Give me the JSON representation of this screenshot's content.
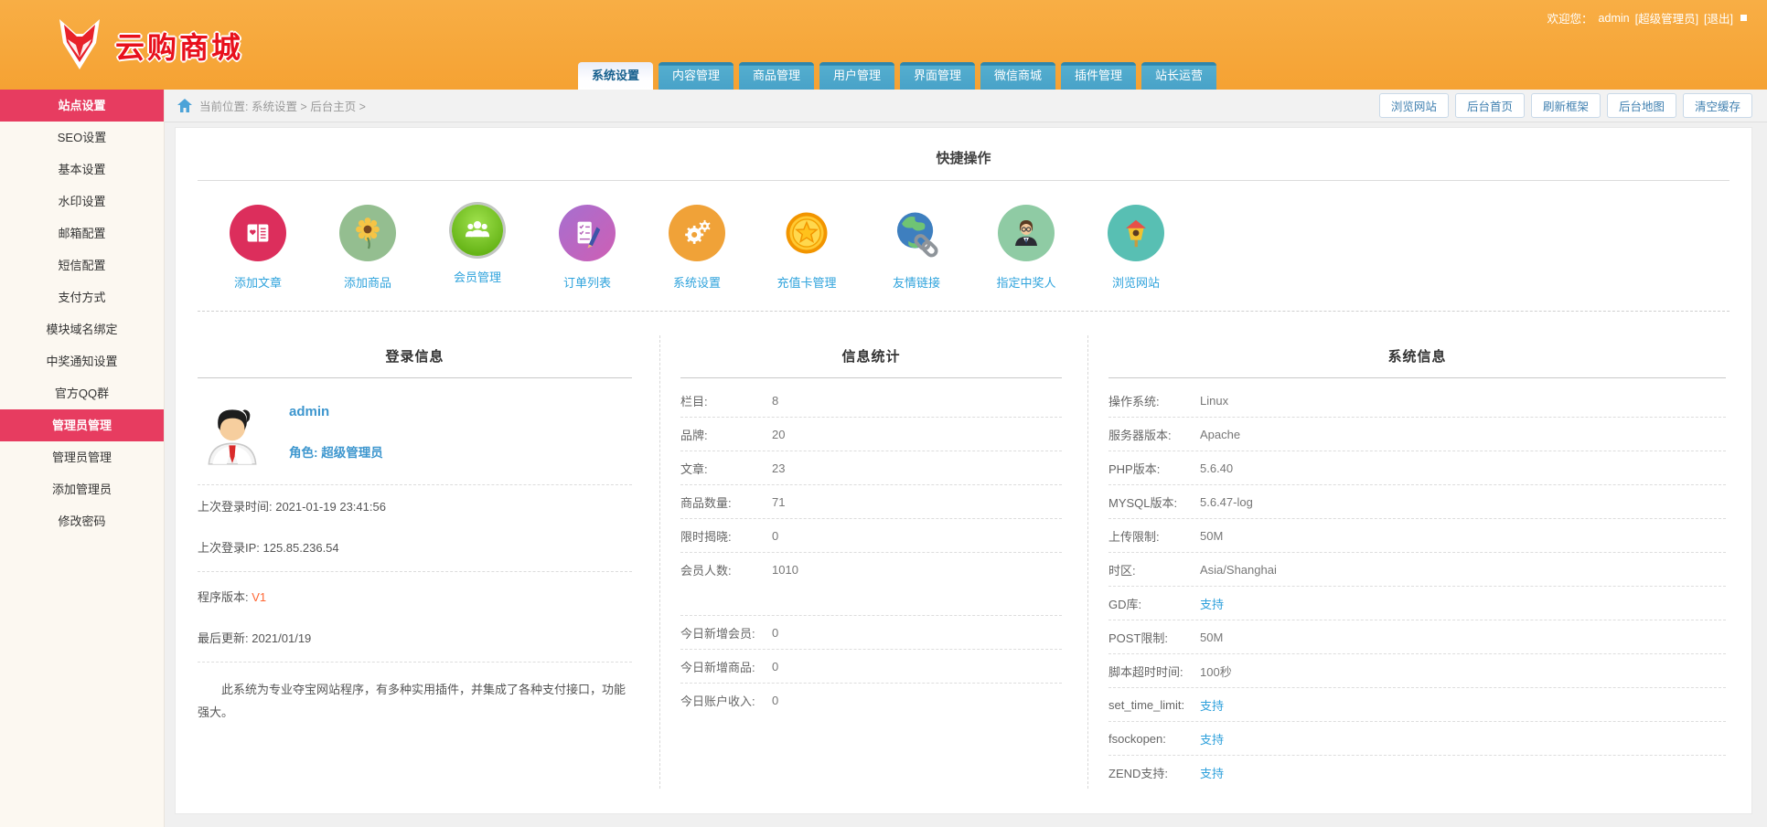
{
  "header": {
    "welcome_prefix": "欢迎您：",
    "username": "admin",
    "role_bracket": "[超级管理员]",
    "logout_label": "[退出]",
    "logo_text": "云购商城",
    "tabs": [
      {
        "label": "系统设置",
        "active": true
      },
      {
        "label": "内容管理",
        "active": false
      },
      {
        "label": "商品管理",
        "active": false
      },
      {
        "label": "用户管理",
        "active": false
      },
      {
        "label": "界面管理",
        "active": false
      },
      {
        "label": "微信商城",
        "active": false
      },
      {
        "label": "插件管理",
        "active": false
      },
      {
        "label": "站长运营",
        "active": false
      }
    ]
  },
  "breadcrumb": {
    "text": "当前位置: 系统设置 > 后台主页 >",
    "actions": [
      {
        "label": "浏览网站"
      },
      {
        "label": "后台首页"
      },
      {
        "label": "刷新框架"
      },
      {
        "label": "后台地图"
      },
      {
        "label": "清空缓存"
      }
    ]
  },
  "sidebar": {
    "items": [
      {
        "label": "站点设置",
        "active": true
      },
      {
        "label": "SEO设置",
        "active": false
      },
      {
        "label": "基本设置",
        "active": false
      },
      {
        "label": "水印设置",
        "active": false
      },
      {
        "label": "邮箱配置",
        "active": false
      },
      {
        "label": "短信配置",
        "active": false
      },
      {
        "label": "支付方式",
        "active": false
      },
      {
        "label": "模块域名绑定",
        "active": false
      },
      {
        "label": "中奖通知设置",
        "active": false
      },
      {
        "label": "官方QQ群",
        "active": false
      },
      {
        "label": "管理员管理",
        "active": true
      },
      {
        "label": "管理员管理",
        "active": false
      },
      {
        "label": "添加管理员",
        "active": false
      },
      {
        "label": "修改密码",
        "active": false
      }
    ]
  },
  "quick": {
    "title": "快捷操作",
    "items": [
      {
        "label": "添加文章",
        "icon": "book-heart-icon",
        "color": "#DC2E5C"
      },
      {
        "label": "添加商品",
        "icon": "sunflower-icon",
        "color": "#94BE90"
      },
      {
        "label": "会员管理",
        "icon": "members-icon",
        "color": "#76C42D"
      },
      {
        "label": "订单列表",
        "icon": "order-list-icon",
        "color": "#BE66C2"
      },
      {
        "label": "系统设置",
        "icon": "gears-icon",
        "color": "#F0A238"
      },
      {
        "label": "充值卡管理",
        "icon": "coin-star-icon",
        "color": "#FFC21C"
      },
      {
        "label": "友情链接",
        "icon": "globe-link-icon",
        "color": "#3E7FBF"
      },
      {
        "label": "指定中奖人",
        "icon": "winner-avatar-icon",
        "color": "#8FCBA4"
      },
      {
        "label": "浏览网站",
        "icon": "birdhouse-icon",
        "color": "#58BFB3"
      }
    ]
  },
  "login_panel": {
    "title": "登录信息",
    "username": "admin",
    "role_line": "角色: 超级管理员",
    "last_login_time": "上次登录时间: 2021-01-19 23:41:56",
    "last_login_ip": "上次登录IP: 125.85.236.54",
    "version_label": "程序版本:",
    "version_value": "V1",
    "last_update": "最后更新: 2021/01/19",
    "description": "此系统为专业夺宝网站程序，有多种实用插件，并集成了各种支付接口，功能强大。"
  },
  "stats_panel": {
    "title": "信息统计",
    "rows": [
      {
        "label": "栏目:",
        "value": "8"
      },
      {
        "label": "品牌:",
        "value": "20"
      },
      {
        "label": "文章:",
        "value": "23"
      },
      {
        "label": "商品数量:",
        "value": "71"
      },
      {
        "label": "限时揭晓:",
        "value": "0"
      },
      {
        "label": "会员人数:",
        "value": "1010"
      }
    ],
    "today_rows": [
      {
        "label": "今日新增会员:",
        "value": "0"
      },
      {
        "label": "今日新增商品:",
        "value": "0"
      },
      {
        "label": "今日账户收入:",
        "value": "0"
      }
    ]
  },
  "system_panel": {
    "title": "系统信息",
    "rows": [
      {
        "label": "操作系统:",
        "value": "Linux",
        "link": false
      },
      {
        "label": "服务器版本:",
        "value": "Apache",
        "link": false
      },
      {
        "label": "PHP版本:",
        "value": "5.6.40",
        "link": false
      },
      {
        "label": "MYSQL版本:",
        "value": "5.6.47-log",
        "link": false
      },
      {
        "label": "上传限制:",
        "value": "50M",
        "link": false
      },
      {
        "label": "时区:",
        "value": "Asia/Shanghai",
        "link": false
      },
      {
        "label": "GD库:",
        "value": "支持",
        "link": true
      },
      {
        "label": "POST限制:",
        "value": "50M",
        "link": false
      },
      {
        "label": "脚本超时时间:",
        "value": "100秒",
        "link": false
      },
      {
        "label": "set_time_limit:",
        "value": "支持",
        "link": true
      },
      {
        "label": "fsockopen:",
        "value": "支持",
        "link": true
      },
      {
        "label": "ZEND支持:",
        "value": "支持",
        "link": true
      }
    ]
  },
  "colors": {
    "header_orange": "#F5A233",
    "tab_blue": "#48A2C8",
    "tab_active_text": "#17608E",
    "sidebar_active_pink": "#E73C60",
    "sidebar_bg": "#FCF8F1",
    "link_blue": "#2EA0DB",
    "quick_label_blue": "#2FA3DC",
    "version_orange": "#FF6633",
    "page_bg": "#F0F0F0"
  }
}
